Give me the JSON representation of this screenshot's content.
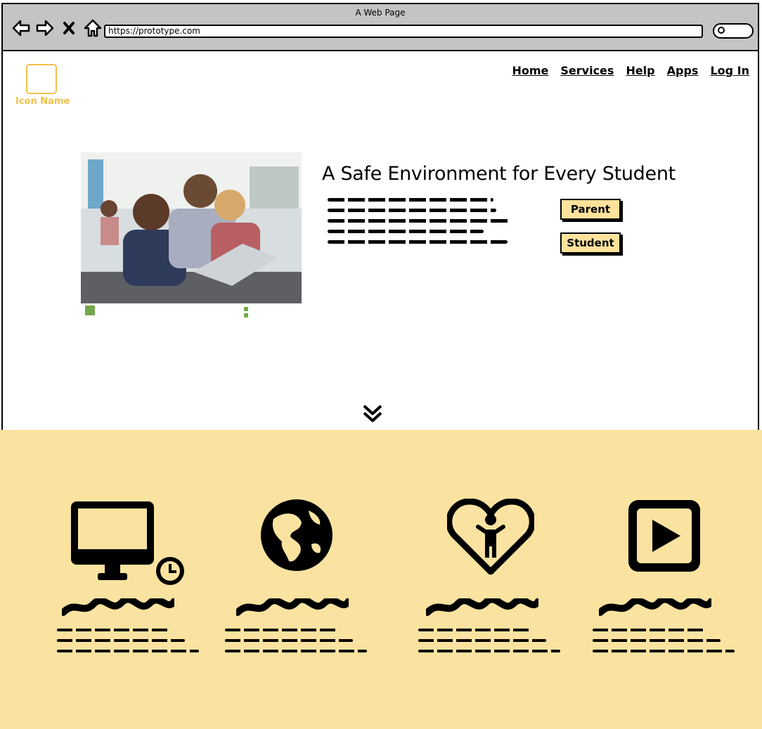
{
  "browser": {
    "title": "A Web Page",
    "url": "https://prototype.com"
  },
  "logo": {
    "label": "Icon Name"
  },
  "nav": [
    "Home",
    "Services",
    "Help",
    "Apps",
    "Log In"
  ],
  "hero": {
    "title": "A Safe Environment for Every Student",
    "buttons": {
      "parent": "Parent",
      "student": "Student"
    }
  },
  "features": [
    {
      "icon": "monitor-clock-icon"
    },
    {
      "icon": "globe-icon"
    },
    {
      "icon": "heart-child-icon"
    },
    {
      "icon": "play-button-icon"
    }
  ],
  "colors": {
    "accent": "#fae3a0",
    "button": "#fce29b",
    "logo": "#f0c14b",
    "chrome": "#c4c4c4"
  }
}
